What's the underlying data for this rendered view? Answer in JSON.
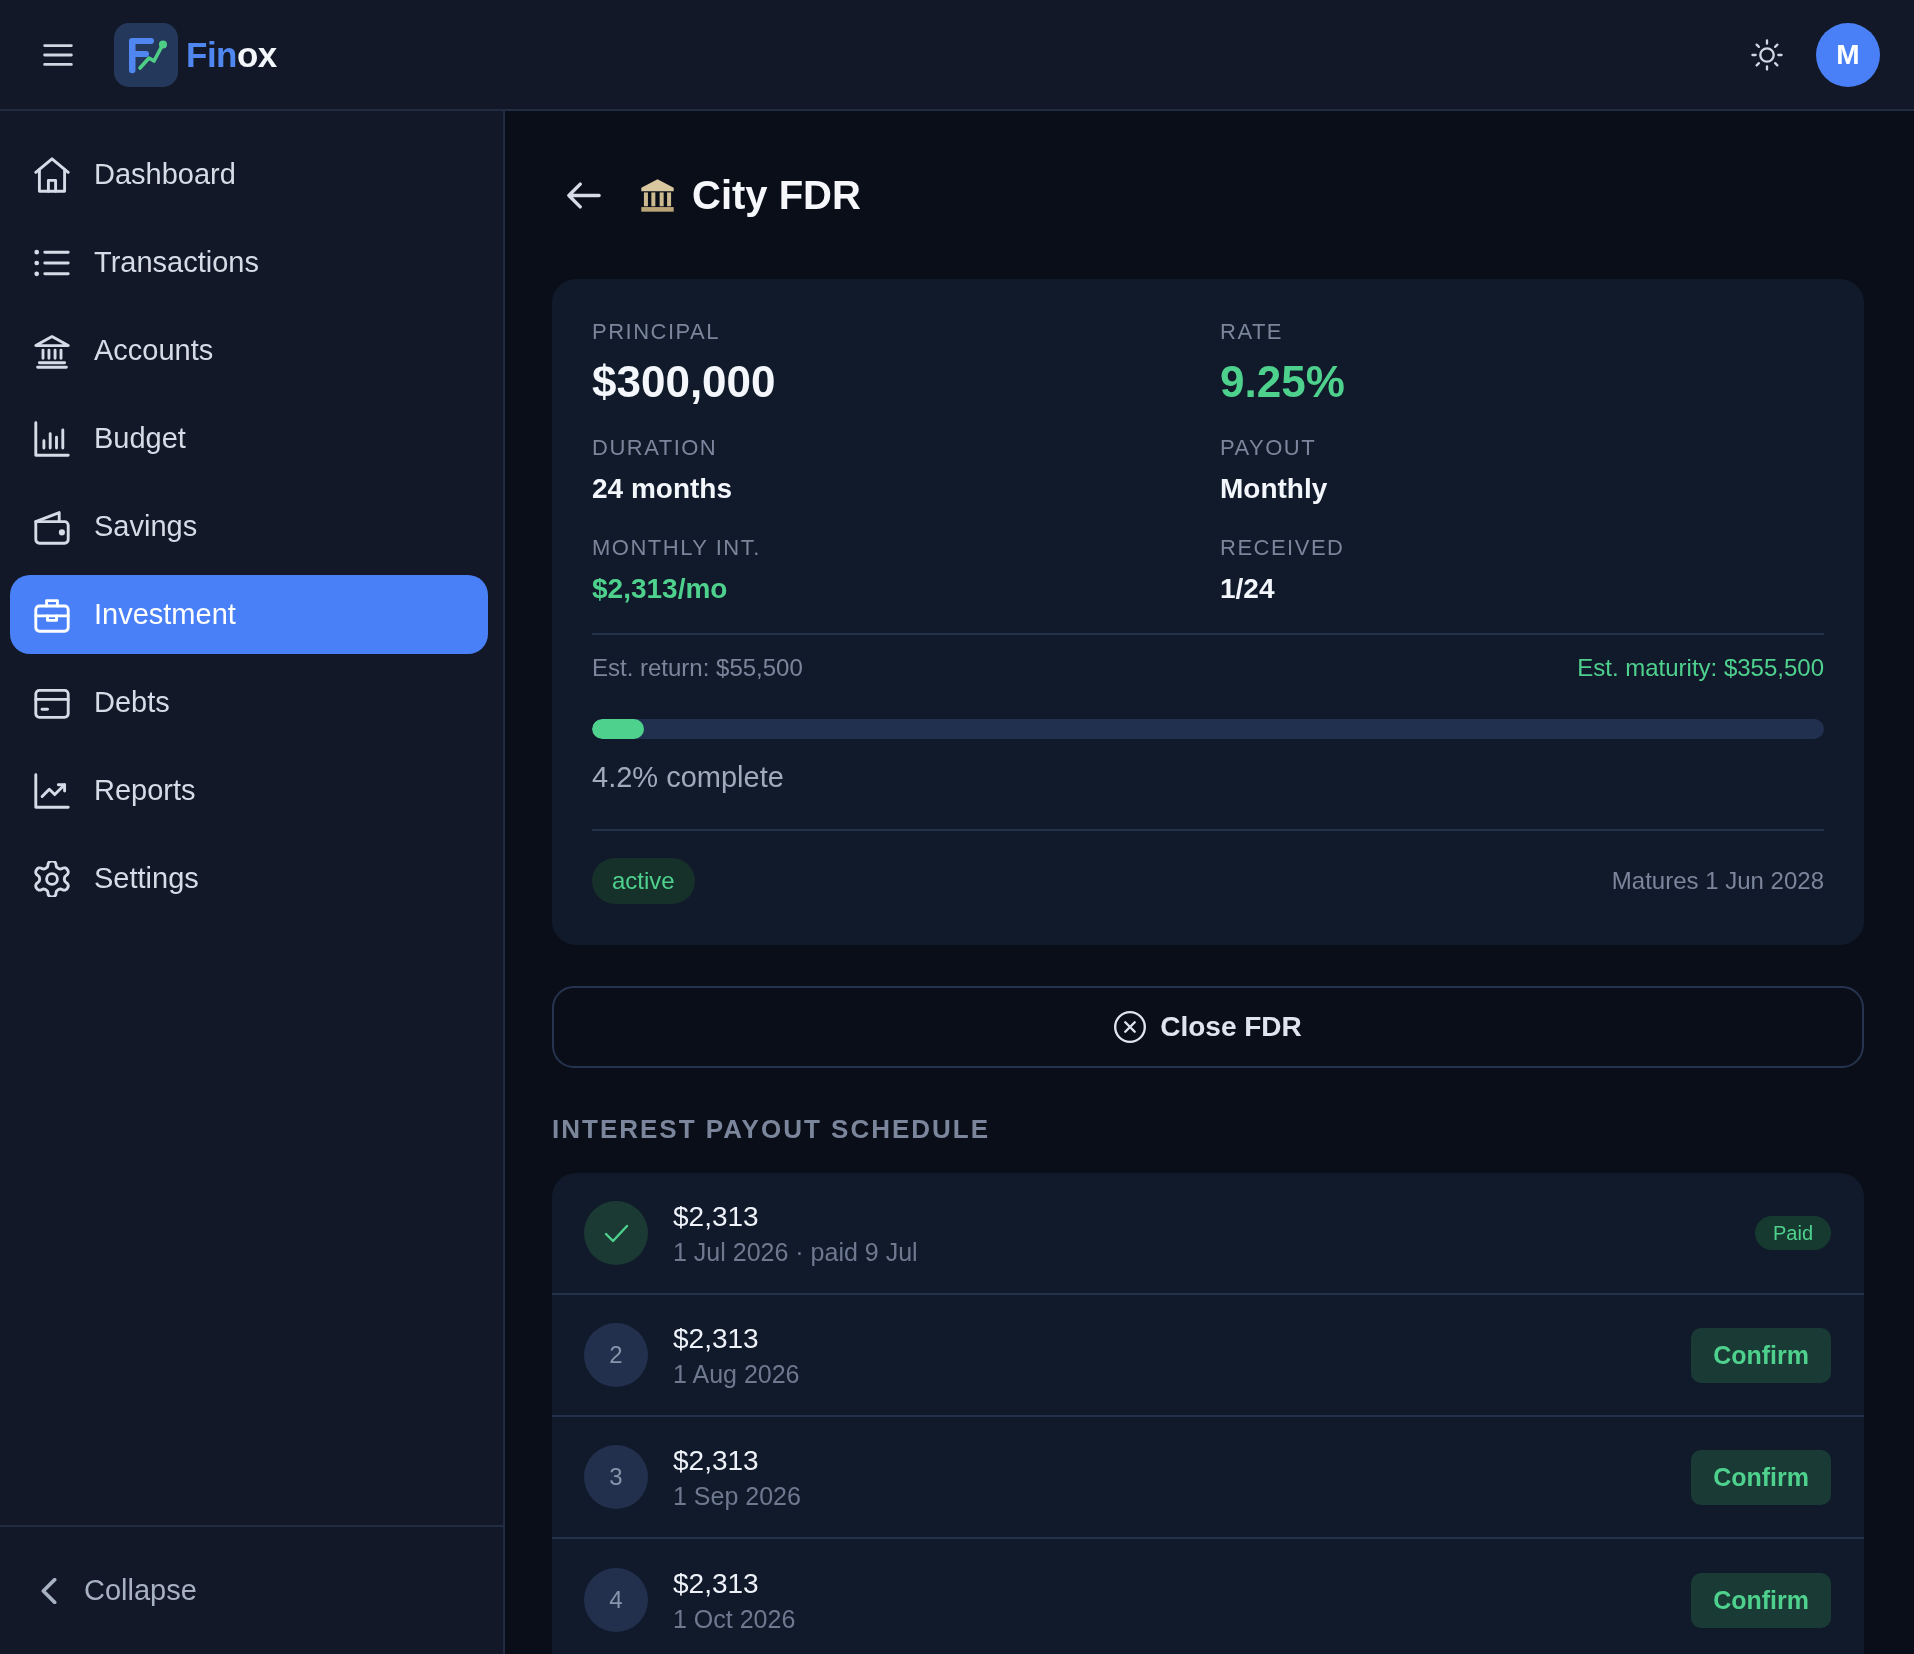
{
  "header": {
    "brand": {
      "accent": "Fin",
      "rest": "ox"
    },
    "avatar": "M"
  },
  "nav": [
    {
      "label": "Dashboard",
      "selected": false
    },
    {
      "label": "Transactions",
      "selected": false
    },
    {
      "label": "Accounts",
      "selected": false
    },
    {
      "label": "Budget",
      "selected": false
    },
    {
      "label": "Savings",
      "selected": false
    },
    {
      "label": "Investment",
      "selected": true
    },
    {
      "label": "Debts",
      "selected": false
    },
    {
      "label": "Reports",
      "selected": false
    },
    {
      "label": "Settings",
      "selected": false
    }
  ],
  "collapse": {
    "label": "Collapse"
  },
  "page": {
    "title": "City FDR"
  },
  "summary_card": {
    "stats": [
      {
        "label": "PRINCIPAL",
        "value": "$300,000",
        "kind": "headline",
        "positive": false
      },
      {
        "label": "RATE",
        "value": "9.25%",
        "kind": "headline",
        "positive": true
      },
      {
        "label": "DURATION",
        "value": "24 months",
        "kind": "detail",
        "positive": false
      },
      {
        "label": "PAYOUT",
        "value": "Monthly",
        "kind": "detail",
        "positive": false
      },
      {
        "label": "MONTHLY INT.",
        "value": "$2,313/mo",
        "kind": "detail",
        "positive": true
      },
      {
        "label": "RECEIVED",
        "value": "1/24",
        "kind": "detail",
        "positive": false
      }
    ],
    "est_return": "Est. return: $55,500",
    "est_maturity": "Est. maturity: $355,500",
    "progress": {
      "level": 0.042,
      "caption": "4.2% complete"
    },
    "status": "active",
    "matures": "Matures 1 Jun 2028"
  },
  "close_button": "Close FDR",
  "schedule": {
    "heading": "INTEREST PAYOUT SCHEDULE",
    "rows": [
      {
        "kind": "paid",
        "amount": "$2,313",
        "date": "1 Jul 2026 · paid 9 Jul",
        "badge": "Paid"
      },
      {
        "kind": "due",
        "number": "2",
        "amount": "$2,313",
        "date": "1 Aug 2026",
        "button": "Confirm"
      },
      {
        "kind": "due",
        "number": "3",
        "amount": "$2,313",
        "date": "1 Sep 2026",
        "button": "Confirm"
      },
      {
        "kind": "due",
        "number": "4",
        "amount": "$2,313",
        "date": "1 Oct 2026",
        "button": "Confirm"
      }
    ]
  }
}
